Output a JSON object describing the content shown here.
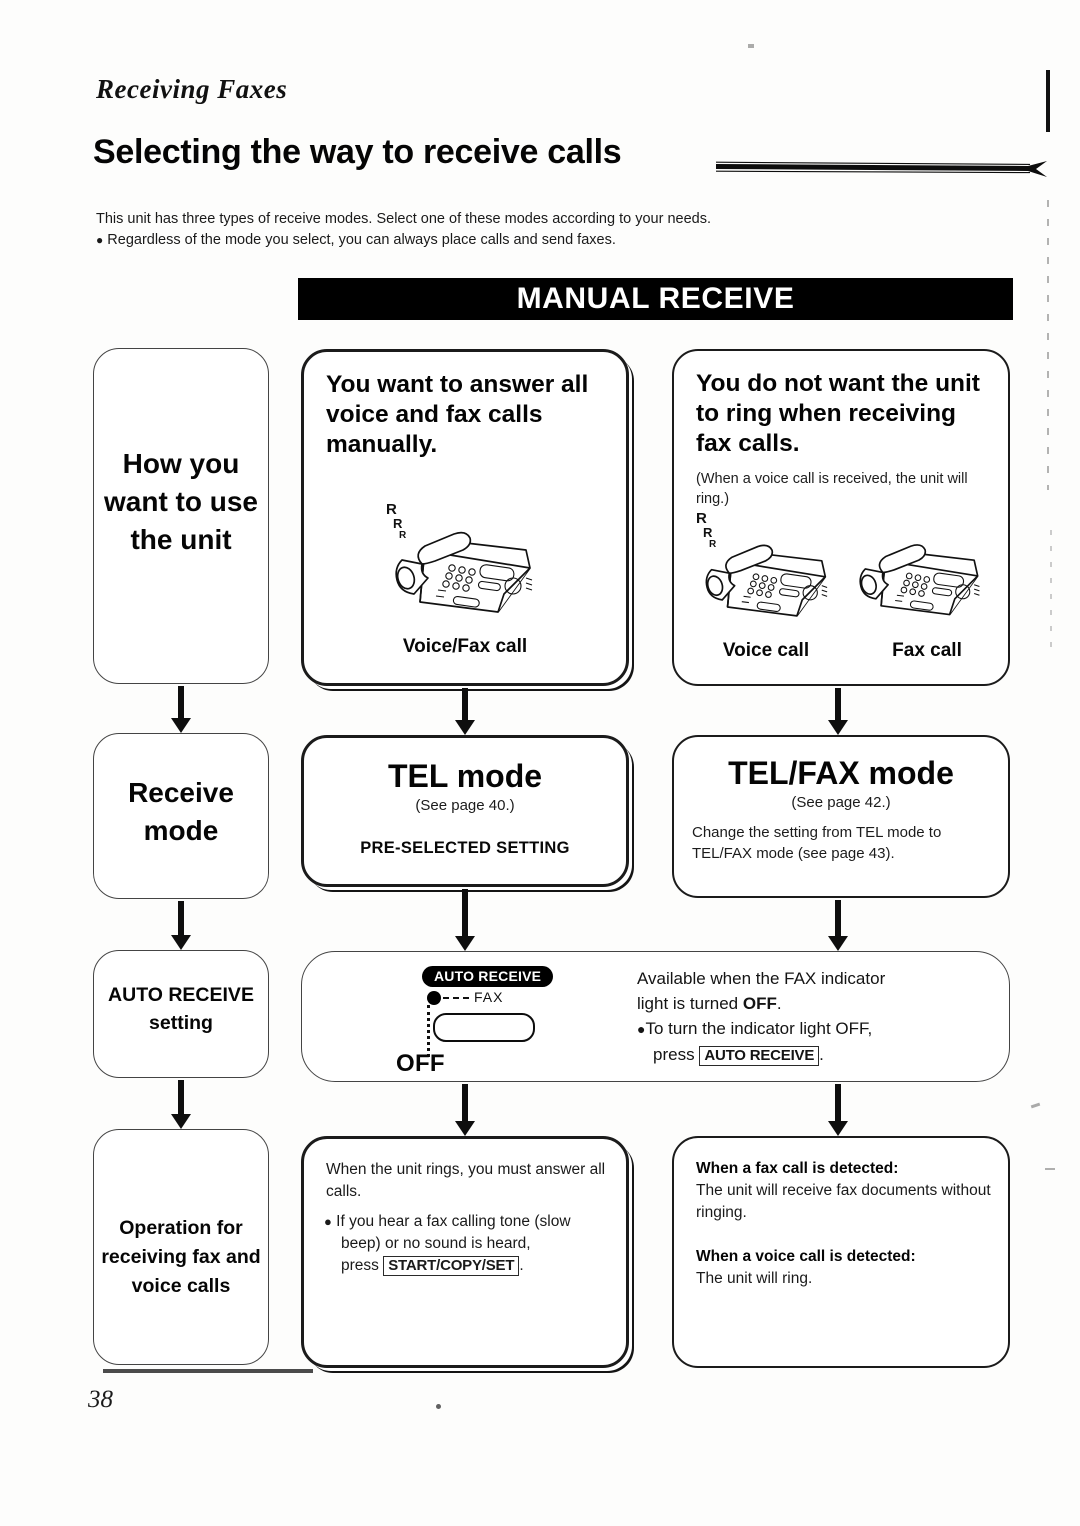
{
  "header": {
    "running_head": "Receiving Faxes",
    "title": "Selecting the way to receive calls"
  },
  "intro": {
    "line1": "This unit has three types of receive modes. Select one of these modes according to your needs.",
    "bullet_dot": "●",
    "line2": "Regardless of the mode you select, you can always place calls and send faxes."
  },
  "banner": {
    "manual_receive": "MANUAL RECEIVE"
  },
  "flow": {
    "row_labels": {
      "how_you_want": "How you want to use the unit",
      "receive_mode": "Receive mode",
      "auto_receive_setting": "AUTO RECEIVE setting",
      "operation_for": "Operation for receiving fax and voice calls"
    },
    "tel_column": {
      "need_heading": "You want to answer all voice and fax calls manually.",
      "illustration_caption": "Voice/Fax call",
      "mode_title": "TEL mode",
      "mode_page_ref": "(See page 40.)",
      "preselected": "PRE-SELECTED SETTING",
      "operation_line1": "When the unit rings, you must answer all calls.",
      "operation_bullet_dot": "●",
      "operation_bullet_line1": "If you hear a fax calling tone (slow",
      "operation_bullet_line2": "beep) or no sound is heard,",
      "operation_bullet_line3_pre": "press",
      "operation_bullet_key": "START/COPY/SET",
      "operation_bullet_line3_post": "."
    },
    "telfax_column": {
      "need_heading": "You do not want the unit to ring when receiving fax calls.",
      "need_subnote": "(When a voice call is received, the unit will ring.)",
      "illustration_caption_left": "Voice call",
      "illustration_caption_right": "Fax call",
      "mode_title": "TEL/FAX mode",
      "mode_page_ref": "(See page 42.)",
      "mode_note": "Change the setting from TEL mode to TEL/FAX mode (see page 43).",
      "fax_detected_head": "When a fax call is detected:",
      "fax_detected_body": "The unit will receive fax documents without ringing.",
      "voice_detected_head": "When a voice call is detected:",
      "voice_detected_body": "The unit will ring."
    }
  },
  "auto_receive_panel": {
    "indicator_pill": "AUTO RECEIVE",
    "fax_label": "FAX",
    "off_label": "OFF",
    "text_line1": "Available when the FAX indicator",
    "text_line2_pre": "light is turned",
    "text_line2_bold": "OFF",
    "text_line2_post": ".",
    "bullet_dot": "●",
    "bullet_line1": "To turn the indicator light OFF,",
    "bullet_line2_pre": "press",
    "bullet_key": "AUTO RECEIVE",
    "bullet_line2_post": "."
  },
  "ring_marks": {
    "mark1": "R",
    "mark2": "R",
    "mark3": "R"
  },
  "footer": {
    "page_number": "38"
  },
  "colors": {
    "ink": "#0d0d0d",
    "paper": "#fdfdfc",
    "banner_bg": "#000000",
    "banner_fg": "#ffffff"
  }
}
